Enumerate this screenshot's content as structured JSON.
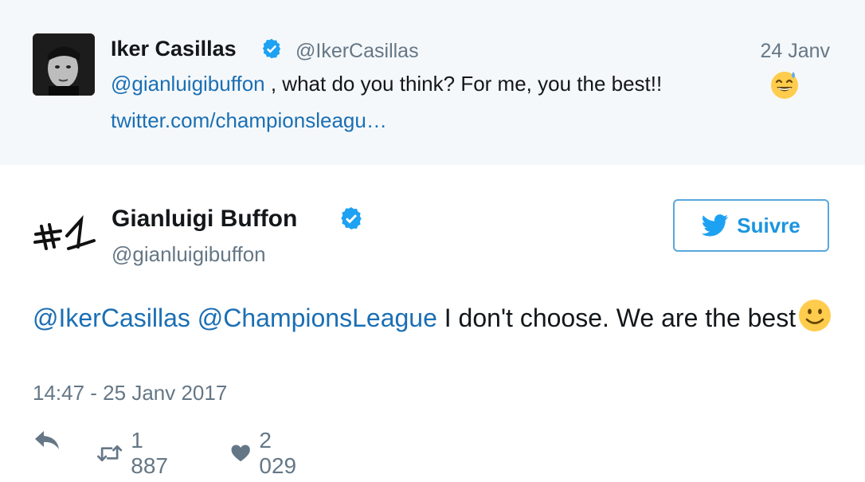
{
  "quoted_tweet": {
    "author_name": "Iker Casillas",
    "handle": "@IkerCasillas",
    "date": "24 Janv",
    "text_mention": "@gianluigibuffon",
    "text_body": " , what do you think? For me, you the best!! ",
    "link": "twitter.com/championsleagu…",
    "emoji": "sweat-smile-emoji"
  },
  "main_tweet": {
    "author_name": "Gianluigi Buffon",
    "handle": "@gianluigibuffon",
    "follow_label": "Suivre",
    "mention_1": "@IkerCasillas",
    "mention_2": "@ChampionsLeague",
    "text_body": " I don't choose. We are the best",
    "emoji": "slightly-smiling-emoji",
    "timestamp": "14:47 - 25 Janv 2017",
    "retweet_count": "1 887",
    "like_count": "2 029"
  },
  "colors": {
    "link": "#1b6fb4",
    "secondary_text": "#657786",
    "verified": "#1da1f2",
    "quoted_bg": "#f5f8fa",
    "follow_border": "#5aa7dd"
  },
  "icons": [
    "verified-badge-icon",
    "twitter-bird-icon",
    "reply-icon",
    "retweet-icon",
    "heart-icon"
  ]
}
